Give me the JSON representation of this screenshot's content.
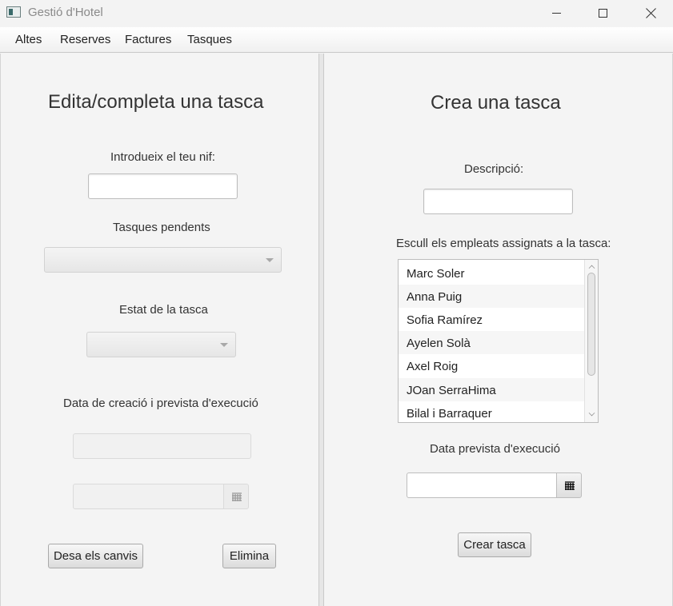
{
  "window": {
    "title": "Gestió d'Hotel",
    "icon": "app-window-icon"
  },
  "menu": {
    "items": [
      "Altes",
      "Reserves",
      "Factures",
      "Tasques"
    ]
  },
  "edit_panel": {
    "heading": "Edita/completa una tasca",
    "nif_label": "Introdueix el teu nif:",
    "nif_value": "",
    "pending_label": "Tasques pendents",
    "pending_selected": "",
    "status_label": "Estat de la tasca",
    "status_selected": "",
    "dates_label": "Data de creació i prevista d'execució",
    "creation_date": "",
    "planned_date": "",
    "save_button": "Desa els canvis",
    "delete_button": "Elimina"
  },
  "create_panel": {
    "heading": "Crea una tasca",
    "description_label": "Descripció:",
    "description_value": "",
    "employees_label": "Escull els empleats assignats a la tasca:",
    "employees": [
      "Marc Soler",
      "Anna Puig",
      "Sofia Ramírez",
      "Ayelen Solà",
      "Axel Roig",
      "JOan SerraHima",
      "Bilal i Barraquer"
    ],
    "planned_label": "Data prevista d'execució",
    "planned_date": "",
    "create_button": "Crear tasca"
  }
}
